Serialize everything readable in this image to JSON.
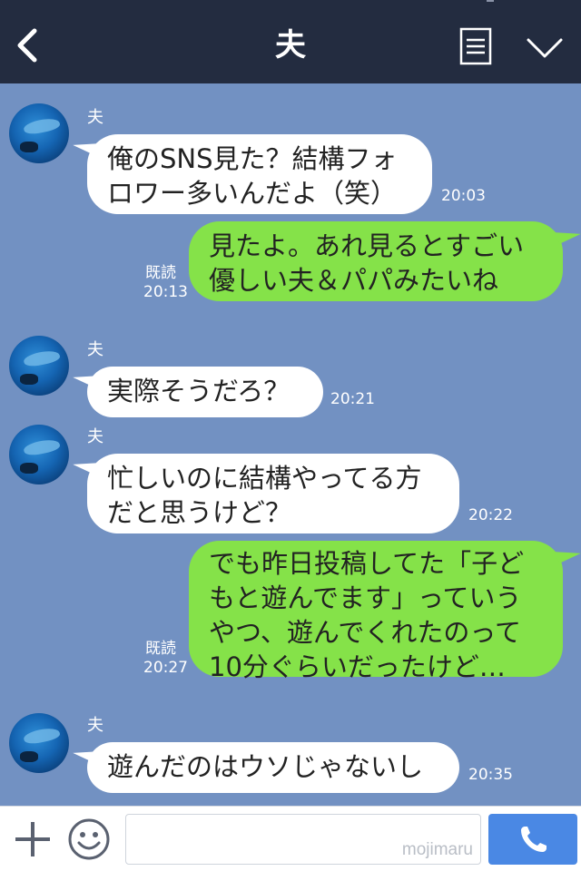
{
  "header": {
    "title": "夫",
    "back_icon": "chevron-left-icon",
    "menu_icon": "note-icon",
    "more_icon": "chevron-down-icon"
  },
  "messages": [
    {
      "side": "in",
      "sender": "夫",
      "text": "俺のSNS見た？結構フォ\nロワー多いんだよ（笑）",
      "time": "20:03"
    },
    {
      "side": "out",
      "read": "既読",
      "text": "見たよ。あれ見るとすごい\n優しい夫＆パパみたいね",
      "time": "20:13"
    },
    {
      "side": "in",
      "sender": "夫",
      "text": "実際そうだろ？",
      "time": "20:21"
    },
    {
      "side": "in",
      "sender": "夫",
      "text": "忙しいのに結構やってる方\nだと思うけど？",
      "time": "20:22"
    },
    {
      "side": "out",
      "read": "既読",
      "text": "でも昨日投稿してた「子ど\nもと遊んでます」っていう\nやつ、遊んでくれたのって\n10分ぐらいだったけど…",
      "time": "20:27"
    },
    {
      "side": "in",
      "sender": "夫",
      "text": "遊んだのはウソじゃないし",
      "time": "20:35"
    }
  ],
  "footer": {
    "plus_icon": "plus-icon",
    "emoji_icon": "smiley-icon",
    "input_value": "",
    "watermark": "mojimaru",
    "call_icon": "phone-icon"
  },
  "colors": {
    "header_bg": "#232c40",
    "chat_bg": "#7291c2",
    "incoming_bubble": "#ffffff",
    "outgoing_bubble": "#85e249",
    "call_button": "#4a88e4"
  }
}
